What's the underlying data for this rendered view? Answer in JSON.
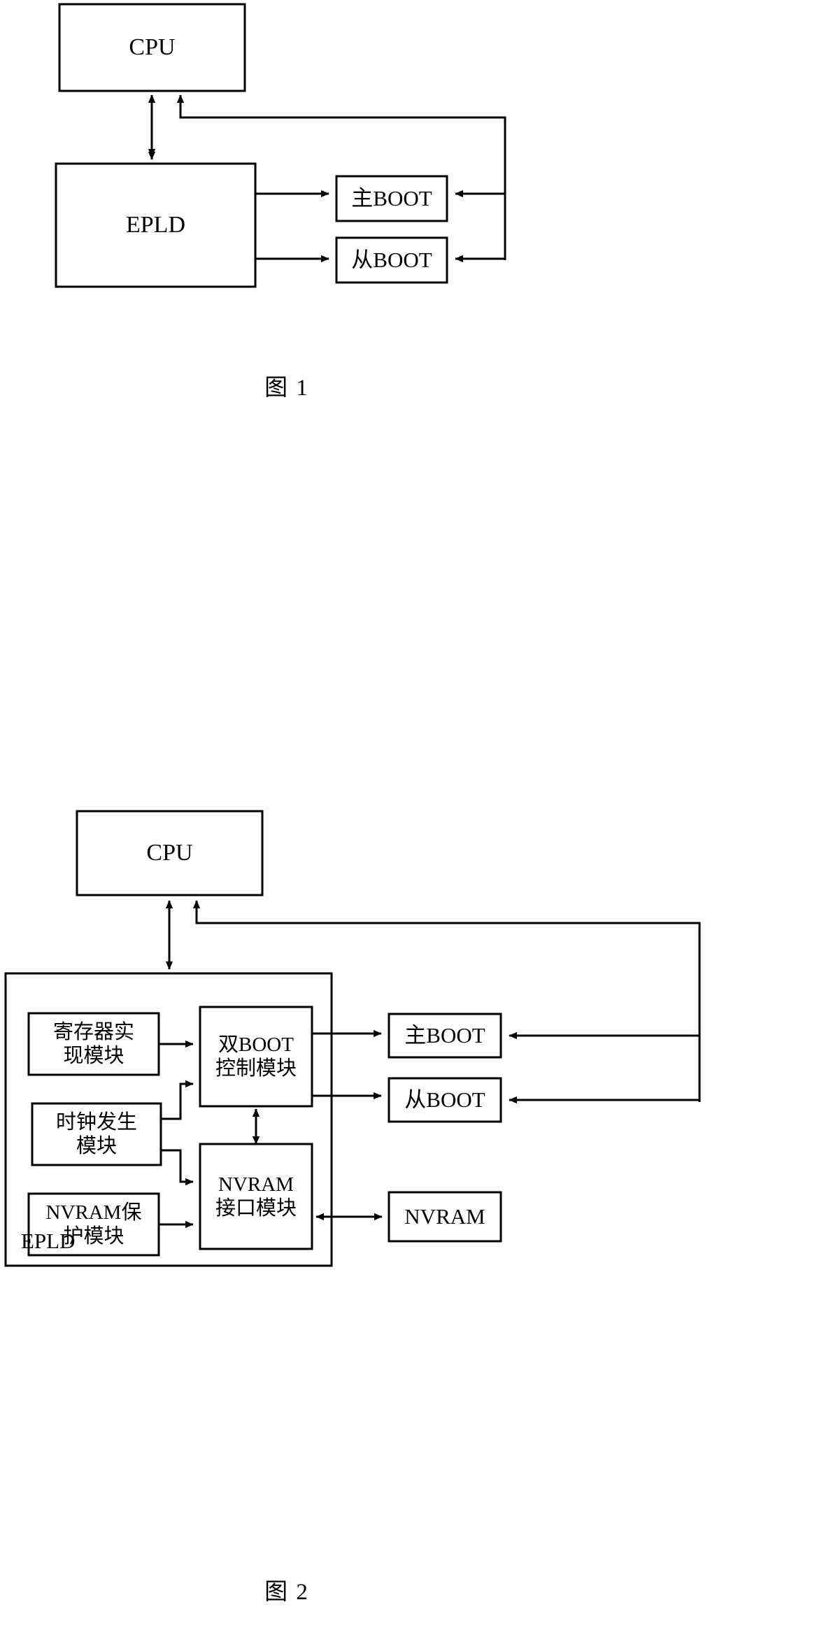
{
  "figure1": {
    "caption": "图  1",
    "nodes": {
      "cpu": "CPU",
      "epld": "EPLD",
      "main_boot": "主BOOT",
      "slave_boot": "从BOOT"
    }
  },
  "figure2": {
    "caption": "图  2",
    "nodes": {
      "cpu": "CPU",
      "epld_container_label": "EPLD",
      "register_module": "寄存器实\n现模块",
      "clock_module": "时钟发生\n模块",
      "nvram_protect_module": "NVRAM保\n护模块",
      "dual_boot_control_module": "双BOOT\n控制模块",
      "nvram_interface_module": "NVRAM\n接口模块",
      "main_boot": "主BOOT",
      "slave_boot": "从BOOT",
      "nvram": "NVRAM"
    }
  },
  "style": {
    "line_color": "#000000",
    "box_fill": "#ffffff",
    "background": "#ffffff"
  }
}
